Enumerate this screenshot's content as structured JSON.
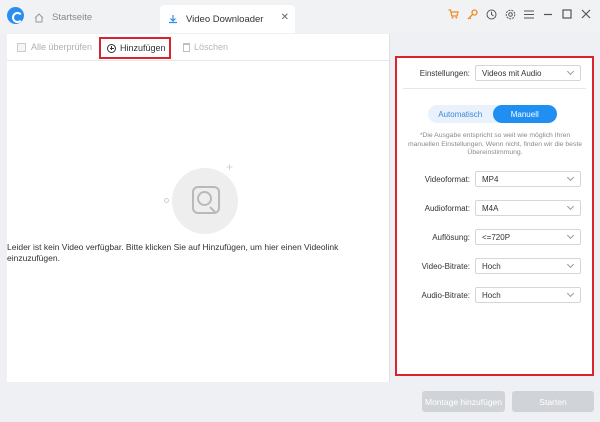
{
  "titlebar": {
    "tabs": [
      {
        "label": "Startseite"
      },
      {
        "label": "Video Downloader"
      }
    ],
    "close_glyph": "✕",
    "icons": [
      "cart-icon",
      "key-icon",
      "history-icon",
      "settings-icon",
      "menu-icon",
      "minimize-icon",
      "maximize-icon",
      "close-icon"
    ],
    "accent": "#2a8ef0"
  },
  "toolbar": {
    "select_all": "Alle überprüfen",
    "add": "Hinzufügen",
    "delete": "Löschen"
  },
  "main": {
    "empty_message": "Leider ist kein Video verfügbar. Bitte klicken Sie auf Hinzufügen, um hier einen Videolink einzuzufügen."
  },
  "settings": {
    "label": "Einstellungen:",
    "value": "Videos mit Audio",
    "mode_auto": "Automatisch",
    "mode_manual": "Manuell",
    "note": "*Die Ausgabe entspricht so weit wie möglich Ihren manuellen Einstellungen. Wenn nicht, finden wir die beste Übereinstimmung.",
    "rows": [
      {
        "label": "Videoformat:",
        "value": "MP4"
      },
      {
        "label": "Audioformat:",
        "value": "M4A"
      },
      {
        "label": "Auflösung:",
        "value": "<=720P"
      },
      {
        "label": "Video-Bitrate:",
        "value": "Hoch"
      },
      {
        "label": "Audio-Bitrate:",
        "value": "Hoch"
      }
    ]
  },
  "footer": {
    "merge": "Montage hinzufügen",
    "start": "Starten"
  },
  "colors": {
    "highlight": "#d9232e",
    "primary": "#1f8ff2",
    "disabled_button": "#d0d3d8"
  }
}
